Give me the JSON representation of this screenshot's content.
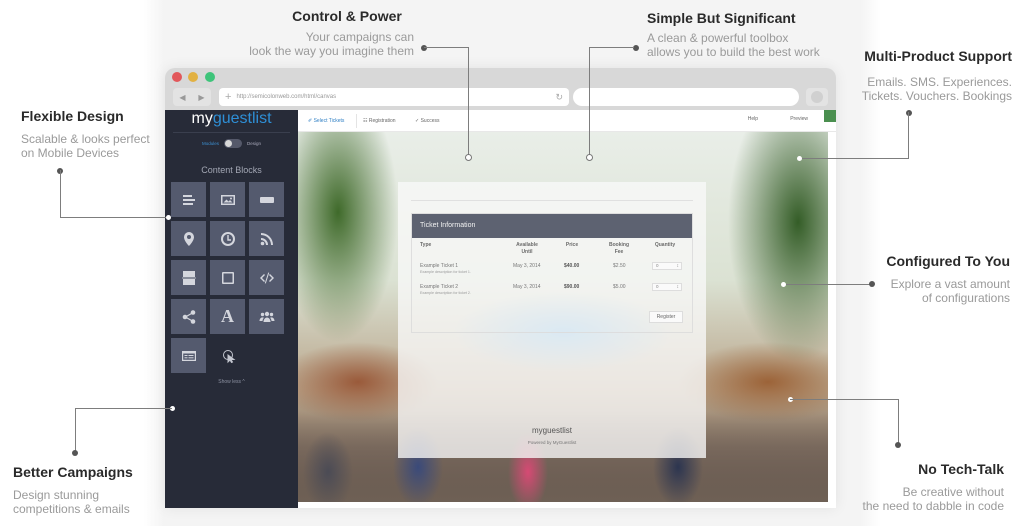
{
  "callouts": {
    "control_power": {
      "title": "Control & Power",
      "line1": "Your campaigns can",
      "line2": "look the way you imagine them"
    },
    "simple_significant": {
      "title": "Simple But Significant",
      "line1": "A clean & powerful toolbox",
      "line2": "allows you to build the best work"
    },
    "multi_product": {
      "title": "Multi-Product Support",
      "line1": "Emails. SMS. Experiences.",
      "line2": "Tickets. Vouchers. Bookings"
    },
    "flexible_design": {
      "title": "Flexible Design",
      "line1": "Scalable & looks perfect",
      "line2": "on Mobile Devices"
    },
    "configured": {
      "title": "Configured To You",
      "line1": "Explore a vast amount",
      "line2": "of configurations"
    },
    "better_campaigns": {
      "title": "Better Campaigns",
      "line1": "Design stunning",
      "line2": "competitions & emails"
    },
    "no_tech_talk": {
      "title": "No Tech-Talk",
      "line1": "Be creative without",
      "line2": "the need to dabble in code"
    }
  },
  "browser": {
    "url": "http://semicolonweb.com/html/canvas",
    "back_icon": "◀",
    "forward_icon": "▶",
    "reload_icon": "↻",
    "new_tab_icon": "+"
  },
  "sidebar": {
    "logo_prefix": "my",
    "logo_accent": "guestlist",
    "toggle_left": "Modules",
    "toggle_right": "Design",
    "content_blocks_title": "Content Blocks",
    "blocks": [
      {
        "name": "text-block",
        "icon": "text-lines"
      },
      {
        "name": "image-block",
        "icon": "image"
      },
      {
        "name": "button-block",
        "icon": "button"
      },
      {
        "name": "map-block",
        "icon": "map-pin"
      },
      {
        "name": "countdown-block",
        "icon": "clock"
      },
      {
        "name": "rss-block",
        "icon": "rss"
      },
      {
        "name": "divider-block",
        "icon": "divider"
      },
      {
        "name": "box-block",
        "icon": "square"
      },
      {
        "name": "code-block",
        "icon": "code"
      },
      {
        "name": "share-block",
        "icon": "share"
      },
      {
        "name": "font-block",
        "icon": "letter-a"
      },
      {
        "name": "group-block",
        "icon": "users"
      },
      {
        "name": "form-block",
        "icon": "form"
      }
    ],
    "show_less": "Show less ^"
  },
  "toolbar": {
    "tabs": [
      "✐ Select Tickets",
      "☷ Registration",
      "✓ Success"
    ],
    "help": "Help",
    "preview": "Preview"
  },
  "ticket_panel": {
    "title": "Ticket Information",
    "columns": [
      "Type",
      "Available Until",
      "Price",
      "Booking Fee",
      "Quantity"
    ],
    "rows": [
      {
        "type": "Example Ticket 1",
        "description": "Example description for ticket 1.",
        "available_until": "May 3, 2014",
        "price": "$40.00",
        "booking_fee": "$2.50",
        "quantity": "0"
      },
      {
        "type": "Example Ticket 2",
        "description": "Example description for ticket 2.",
        "available_until": "May 3, 2014",
        "price": "$90.00",
        "booking_fee": "$5.00",
        "quantity": "0"
      }
    ],
    "register_label": "Register",
    "footer_logo": "myguestlist",
    "powered_by": "Powered by MyGuestlist"
  }
}
